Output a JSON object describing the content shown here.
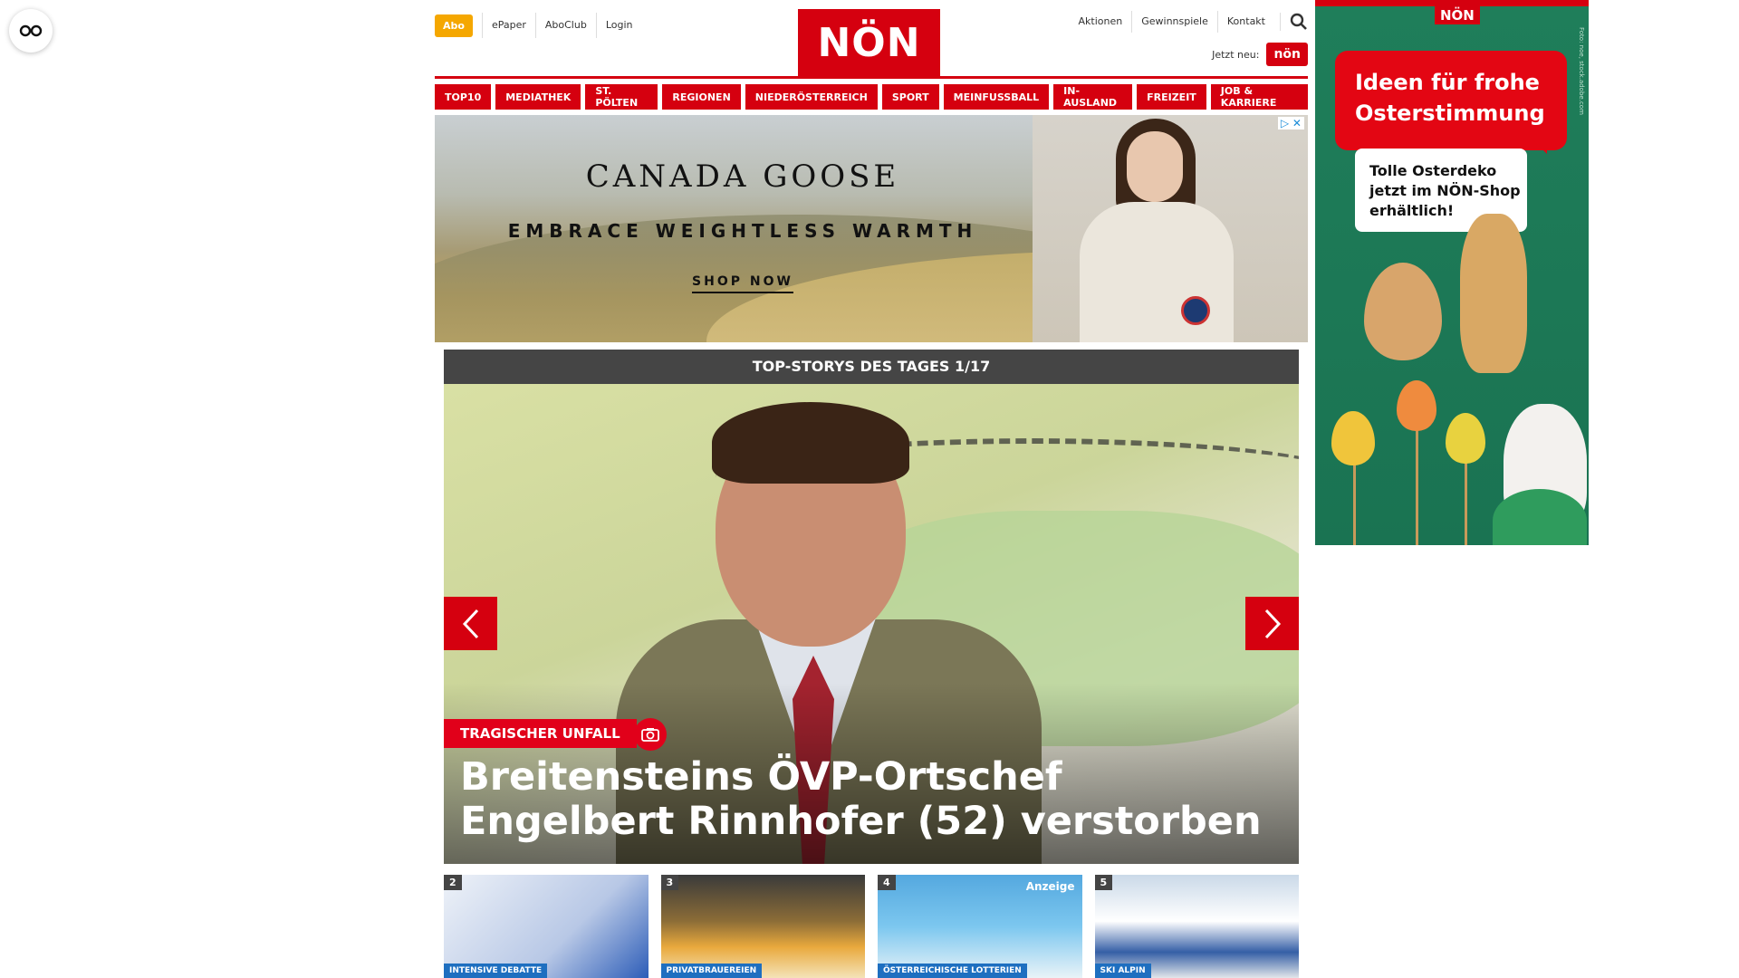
{
  "reader_mode": {
    "icon": "reader-glasses-icon"
  },
  "header": {
    "abo_label": "Abo",
    "top_links": [
      "ePaper",
      "AboClub",
      "Login"
    ],
    "logo_text": "NÖN",
    "right_links": [
      "Aktionen",
      "Gewinnspiele",
      "Kontakt"
    ],
    "search_icon": "search-icon",
    "jetzt_label": "Jetzt neu:",
    "jetzt_badge": "nön",
    "brand_color": "#d5000f"
  },
  "nav": {
    "items": [
      "TOP10",
      "MEDIATHEK",
      "ST. PÖLTEN",
      "REGIONEN",
      "NIEDERÖSTERREICH",
      "SPORT",
      "MEINFUSSBALL",
      "IN-AUSLAND",
      "FREIZEIT",
      "JOB & KARRIERE"
    ]
  },
  "banner_ad": {
    "brand": "CANADA GOOSE",
    "tagline": "EMBRACE WEIGHTLESS WARMTH",
    "cta": "SHOP NOW",
    "adchoices": "▷ ✕"
  },
  "slider": {
    "heading": "TOP-STORYS DES TAGES 1/17",
    "tag": "TRAGISCHER UNFALL",
    "title": "Breitensteins ÖVP-Ortschef Engelbert Rinnhofer (52) verstorben",
    "prev_icon": "chevron-left-icon",
    "next_icon": "chevron-right-icon",
    "camera_icon": "camera-icon"
  },
  "teasers": [
    {
      "num": "2",
      "category": "INTENSIVE DEBATTE",
      "ad": ""
    },
    {
      "num": "3",
      "category": "PRIVATBRAUEREIEN",
      "ad": ""
    },
    {
      "num": "4",
      "category": "ÖSTERREICHISCHE LOTTERIEN",
      "ad": "Anzeige"
    },
    {
      "num": "5",
      "category": "SKI ALPIN",
      "ad": ""
    }
  ],
  "sky_ad": {
    "logo": "NÖN",
    "headline": "Ideen für frohe Osterstimmung",
    "note": "Tolle Osterdeko jetzt im NÖN-Shop erhältlich!",
    "credit": "Foto: noe, stock.adobe.com"
  }
}
